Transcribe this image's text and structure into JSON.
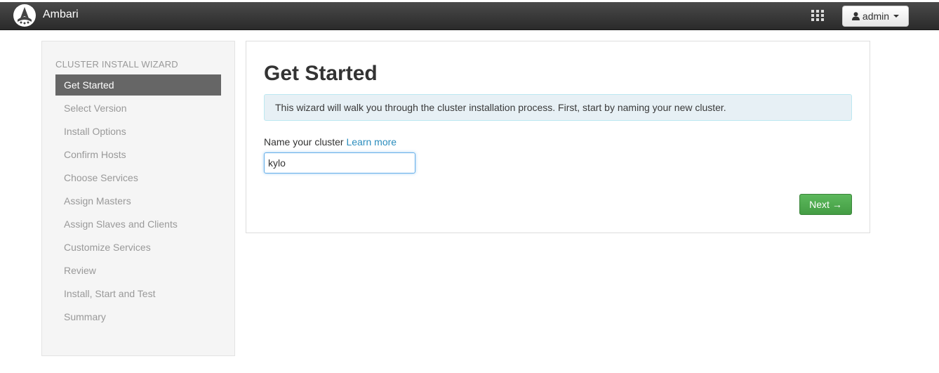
{
  "app": {
    "brand": "Ambari",
    "user_label": "admin",
    "icons": {
      "logo": "ambari-logo-icon",
      "apps": "grid-icon",
      "user": "user-icon",
      "dropdown": "caret-down-icon"
    }
  },
  "sidebar": {
    "heading": "CLUSTER INSTALL WIZARD",
    "active_index": 0,
    "items": [
      {
        "label": "Get Started"
      },
      {
        "label": "Select Version"
      },
      {
        "label": "Install Options"
      },
      {
        "label": "Confirm Hosts"
      },
      {
        "label": "Choose Services"
      },
      {
        "label": "Assign Masters"
      },
      {
        "label": "Assign Slaves and Clients"
      },
      {
        "label": "Customize Services"
      },
      {
        "label": "Review"
      },
      {
        "label": "Install, Start and Test"
      },
      {
        "label": "Summary"
      }
    ]
  },
  "main": {
    "title": "Get Started",
    "info_text": "This wizard will walk you through the cluster installation process. First, start by naming your new cluster.",
    "field_label": "Name your cluster",
    "learn_more": "Learn more",
    "cluster_name_value": "kylo",
    "next_label": "Next →"
  },
  "colors": {
    "topbar": "#333333",
    "active_nav": "#666666",
    "next_button": "#5cb85c",
    "link": "#2a8cbd",
    "info_bg": "#e7f0f5"
  }
}
